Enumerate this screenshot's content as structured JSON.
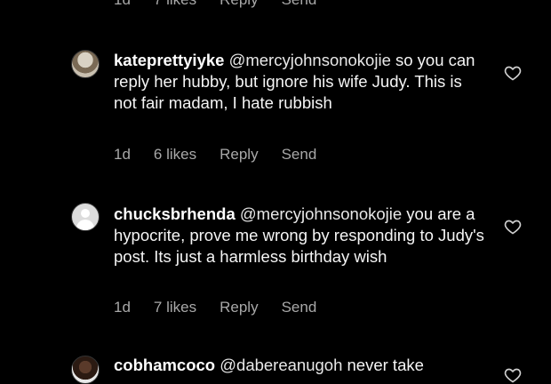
{
  "top_meta": {
    "time": "1d",
    "likes": "7 likes",
    "reply": "Reply",
    "send": "Send"
  },
  "comments": [
    {
      "username": "kateprettyiyke",
      "mention": "@mercyjohnsonokojie",
      "text": " so you can reply her hubby, but ignore his wife Judy. This is not fair madam, I hate rubbish",
      "time": "1d",
      "likes": "6 likes",
      "reply": "Reply",
      "send": "Send"
    },
    {
      "username": "chucksbrhenda",
      "mention": "@mercyjohnsonokojie",
      "text": " you are a hypocrite, prove me wrong by responding to Judy's post. Its just a harmless birthday wish",
      "time": "1d",
      "likes": "7 likes",
      "reply": "Reply",
      "send": "Send"
    },
    {
      "username": "cobhamcoco",
      "mention": "@dabereanugoh",
      "text": " never take"
    }
  ],
  "icons": {
    "like": "heart-outline-icon"
  }
}
